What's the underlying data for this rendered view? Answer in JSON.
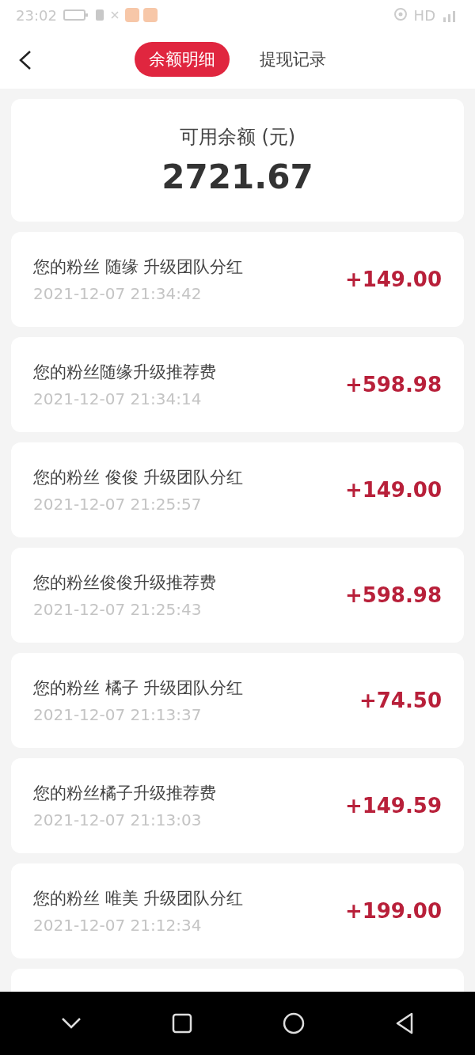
{
  "status_bar": {
    "time": "23:02",
    "network": "HD"
  },
  "header": {
    "tabs": [
      {
        "label": "余额明细",
        "selected": true
      },
      {
        "label": "提现记录",
        "selected": false
      }
    ]
  },
  "balance": {
    "label": "可用余额 (元)",
    "amount": "2721.67"
  },
  "records": [
    {
      "title": "您的粉丝 随缘 升级团队分红",
      "time": "2021-12-07 21:34:42",
      "amount": "+149.00"
    },
    {
      "title": "您的粉丝随缘升级推荐费",
      "time": "2021-12-07 21:34:14",
      "amount": "+598.98"
    },
    {
      "title": "您的粉丝 俊俊 升级团队分红",
      "time": "2021-12-07 21:25:57",
      "amount": "+149.00"
    },
    {
      "title": "您的粉丝俊俊升级推荐费",
      "time": "2021-12-07 21:25:43",
      "amount": "+598.98"
    },
    {
      "title": "您的粉丝 橘子 升级团队分红",
      "time": "2021-12-07 21:13:37",
      "amount": "+74.50"
    },
    {
      "title": "您的粉丝橘子升级推荐费",
      "time": "2021-12-07 21:13:03",
      "amount": "+149.59"
    },
    {
      "title": "您的粉丝 唯美 升级团队分红",
      "time": "2021-12-07 21:12:34",
      "amount": "+199.00"
    }
  ]
}
